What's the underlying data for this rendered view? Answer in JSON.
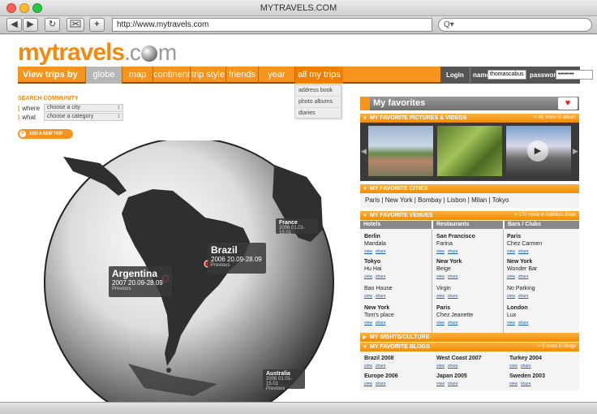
{
  "window": {
    "title": "MYTRAVELS.COM"
  },
  "browser": {
    "url": "http://www.mytravels.com",
    "search_placeholder": "Q▾",
    "back": "◀",
    "forward": "▶",
    "reload": "↻",
    "add": "+"
  },
  "logo": {
    "main": "mytravels",
    "suffix": "c",
    "tail": "m"
  },
  "nav": {
    "label": "View trips by",
    "tabs": [
      "globe",
      "map",
      "continent",
      "trip style",
      "friends",
      "year",
      "all my trips"
    ],
    "dropdown": [
      "address book",
      "photo albums",
      "diaries"
    ],
    "login_button": "Login",
    "name_label": "name",
    "name_value": "thomascabus",
    "password_label": "password",
    "password_value": "••••••••"
  },
  "search": {
    "heading": "SEARCH COMMUNITY",
    "where_label": "where",
    "where_value": "choose a city",
    "what_label": "what",
    "what_value": "choose a category",
    "add_trip": "ADD A NEW TRIP"
  },
  "globe": {
    "callouts": [
      {
        "name": "France",
        "year": "2006",
        "dates": "01.01-15.01",
        "prev": ""
      },
      {
        "name": "Brazil",
        "year": "2006",
        "dates": "20.09-28.09",
        "prev": "Previous"
      },
      {
        "name": "Argentina",
        "year": "2007",
        "dates": "20.09-28.09",
        "prev": "Previous"
      },
      {
        "name": "Australia",
        "year": "2006",
        "dates": "01.01-15.01",
        "prev": "Previous"
      }
    ]
  },
  "favorites": {
    "title": "My favorites",
    "pictures": {
      "title": "MY FAVORITE PICTURES & VIDEOS",
      "more": "> 45 more in album"
    },
    "cities": {
      "title": "MY FAVORITE CITIES",
      "list": [
        "Paris",
        "New York",
        "Bombay",
        "Lisbon",
        "Milan",
        "Tokyo"
      ]
    },
    "venues": {
      "title": "MY FAVORITE VENUES",
      "more": "> 170 more in Address Book",
      "columns": [
        {
          "head": "Hotels",
          "items": [
            {
              "city": "Berlin",
              "place": "Mandala"
            },
            {
              "city": "Tokyo",
              "place": "Hu Hai"
            },
            {
              "city": "",
              "place": "Bao House"
            },
            {
              "city": "New York",
              "place": "Tom's place"
            }
          ]
        },
        {
          "head": "Restaurants",
          "items": [
            {
              "city": "San Francisco",
              "place": "Farina"
            },
            {
              "city": "New York",
              "place": "Beige"
            },
            {
              "city": "",
              "place": "Virgin"
            },
            {
              "city": "Paris",
              "place": "Chez Jeanette"
            }
          ]
        },
        {
          "head": "Bars / Clubs",
          "items": [
            {
              "city": "Paris",
              "place": "Chez Carmen"
            },
            {
              "city": "New York",
              "place": "Wonder Bar"
            },
            {
              "city": "",
              "place": "No Parking"
            },
            {
              "city": "London",
              "place": "Lux"
            }
          ]
        }
      ],
      "view": "view",
      "share": "share"
    },
    "sights": {
      "title": "MY SIGHTS/CULTURE"
    },
    "blogs": {
      "title": "MY FAVORITE BLOGS",
      "more": "> 5 more in Blogs",
      "items": [
        {
          "title": "Brazil 2008"
        },
        {
          "title": "West Coast 2007"
        },
        {
          "title": "Turkey 2004"
        },
        {
          "title": "Europe 2006"
        },
        {
          "title": "Japan 2005"
        },
        {
          "title": "Sweden 2003"
        }
      ]
    }
  },
  "colors": {
    "accent": "#f7941d",
    "dark": "#555555",
    "link": "#1a5fb4"
  }
}
